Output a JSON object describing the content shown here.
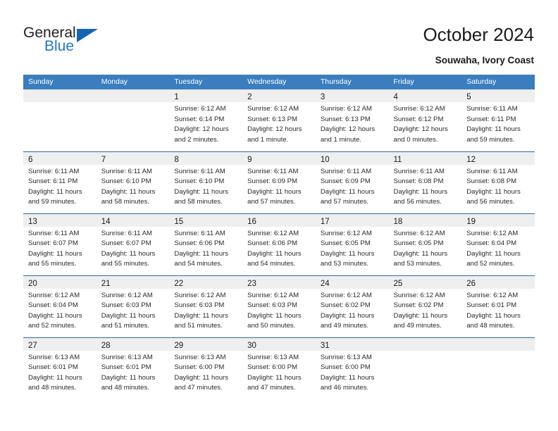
{
  "brand": {
    "name_top": "General",
    "name_bottom": "Blue",
    "triangle_icon": "triangle-logo-icon",
    "color_dark": "#231f20",
    "color_blue": "#2277cc"
  },
  "header": {
    "title": "October 2024",
    "subtitle": "Souwaha, Ivory Coast"
  },
  "theme": {
    "header_blue": "#3a7ebf",
    "row_divider_blue": "#2e6da4",
    "daynum_band_gray": "#efefef"
  },
  "calendar": {
    "weekday_headers": [
      "Sunday",
      "Monday",
      "Tuesday",
      "Wednesday",
      "Thursday",
      "Friday",
      "Saturday"
    ],
    "weeks": [
      [
        {
          "day": "",
          "lines": []
        },
        {
          "day": "",
          "lines": []
        },
        {
          "day": "1",
          "lines": [
            "Sunrise: 6:12 AM",
            "Sunset: 6:14 PM",
            "Daylight: 12 hours and 2 minutes."
          ]
        },
        {
          "day": "2",
          "lines": [
            "Sunrise: 6:12 AM",
            "Sunset: 6:13 PM",
            "Daylight: 12 hours and 1 minute."
          ]
        },
        {
          "day": "3",
          "lines": [
            "Sunrise: 6:12 AM",
            "Sunset: 6:13 PM",
            "Daylight: 12 hours and 1 minute."
          ]
        },
        {
          "day": "4",
          "lines": [
            "Sunrise: 6:12 AM",
            "Sunset: 6:12 PM",
            "Daylight: 12 hours and 0 minutes."
          ]
        },
        {
          "day": "5",
          "lines": [
            "Sunrise: 6:11 AM",
            "Sunset: 6:11 PM",
            "Daylight: 11 hours and 59 minutes."
          ]
        }
      ],
      [
        {
          "day": "6",
          "lines": [
            "Sunrise: 6:11 AM",
            "Sunset: 6:11 PM",
            "Daylight: 11 hours and 59 minutes."
          ]
        },
        {
          "day": "7",
          "lines": [
            "Sunrise: 6:11 AM",
            "Sunset: 6:10 PM",
            "Daylight: 11 hours and 58 minutes."
          ]
        },
        {
          "day": "8",
          "lines": [
            "Sunrise: 6:11 AM",
            "Sunset: 6:10 PM",
            "Daylight: 11 hours and 58 minutes."
          ]
        },
        {
          "day": "9",
          "lines": [
            "Sunrise: 6:11 AM",
            "Sunset: 6:09 PM",
            "Daylight: 11 hours and 57 minutes."
          ]
        },
        {
          "day": "10",
          "lines": [
            "Sunrise: 6:11 AM",
            "Sunset: 6:09 PM",
            "Daylight: 11 hours and 57 minutes."
          ]
        },
        {
          "day": "11",
          "lines": [
            "Sunrise: 6:11 AM",
            "Sunset: 6:08 PM",
            "Daylight: 11 hours and 56 minutes."
          ]
        },
        {
          "day": "12",
          "lines": [
            "Sunrise: 6:11 AM",
            "Sunset: 6:08 PM",
            "Daylight: 11 hours and 56 minutes."
          ]
        }
      ],
      [
        {
          "day": "13",
          "lines": [
            "Sunrise: 6:11 AM",
            "Sunset: 6:07 PM",
            "Daylight: 11 hours and 55 minutes."
          ]
        },
        {
          "day": "14",
          "lines": [
            "Sunrise: 6:11 AM",
            "Sunset: 6:07 PM",
            "Daylight: 11 hours and 55 minutes."
          ]
        },
        {
          "day": "15",
          "lines": [
            "Sunrise: 6:11 AM",
            "Sunset: 6:06 PM",
            "Daylight: 11 hours and 54 minutes."
          ]
        },
        {
          "day": "16",
          "lines": [
            "Sunrise: 6:12 AM",
            "Sunset: 6:06 PM",
            "Daylight: 11 hours and 54 minutes."
          ]
        },
        {
          "day": "17",
          "lines": [
            "Sunrise: 6:12 AM",
            "Sunset: 6:05 PM",
            "Daylight: 11 hours and 53 minutes."
          ]
        },
        {
          "day": "18",
          "lines": [
            "Sunrise: 6:12 AM",
            "Sunset: 6:05 PM",
            "Daylight: 11 hours and 53 minutes."
          ]
        },
        {
          "day": "19",
          "lines": [
            "Sunrise: 6:12 AM",
            "Sunset: 6:04 PM",
            "Daylight: 11 hours and 52 minutes."
          ]
        }
      ],
      [
        {
          "day": "20",
          "lines": [
            "Sunrise: 6:12 AM",
            "Sunset: 6:04 PM",
            "Daylight: 11 hours and 52 minutes."
          ]
        },
        {
          "day": "21",
          "lines": [
            "Sunrise: 6:12 AM",
            "Sunset: 6:03 PM",
            "Daylight: 11 hours and 51 minutes."
          ]
        },
        {
          "day": "22",
          "lines": [
            "Sunrise: 6:12 AM",
            "Sunset: 6:03 PM",
            "Daylight: 11 hours and 51 minutes."
          ]
        },
        {
          "day": "23",
          "lines": [
            "Sunrise: 6:12 AM",
            "Sunset: 6:03 PM",
            "Daylight: 11 hours and 50 minutes."
          ]
        },
        {
          "day": "24",
          "lines": [
            "Sunrise: 6:12 AM",
            "Sunset: 6:02 PM",
            "Daylight: 11 hours and 49 minutes."
          ]
        },
        {
          "day": "25",
          "lines": [
            "Sunrise: 6:12 AM",
            "Sunset: 6:02 PM",
            "Daylight: 11 hours and 49 minutes."
          ]
        },
        {
          "day": "26",
          "lines": [
            "Sunrise: 6:12 AM",
            "Sunset: 6:01 PM",
            "Daylight: 11 hours and 48 minutes."
          ]
        }
      ],
      [
        {
          "day": "27",
          "lines": [
            "Sunrise: 6:13 AM",
            "Sunset: 6:01 PM",
            "Daylight: 11 hours and 48 minutes."
          ]
        },
        {
          "day": "28",
          "lines": [
            "Sunrise: 6:13 AM",
            "Sunset: 6:01 PM",
            "Daylight: 11 hours and 48 minutes."
          ]
        },
        {
          "day": "29",
          "lines": [
            "Sunrise: 6:13 AM",
            "Sunset: 6:00 PM",
            "Daylight: 11 hours and 47 minutes."
          ]
        },
        {
          "day": "30",
          "lines": [
            "Sunrise: 6:13 AM",
            "Sunset: 6:00 PM",
            "Daylight: 11 hours and 47 minutes."
          ]
        },
        {
          "day": "31",
          "lines": [
            "Sunrise: 6:13 AM",
            "Sunset: 6:00 PM",
            "Daylight: 11 hours and 46 minutes."
          ]
        },
        {
          "day": "",
          "lines": []
        },
        {
          "day": "",
          "lines": []
        }
      ]
    ]
  }
}
